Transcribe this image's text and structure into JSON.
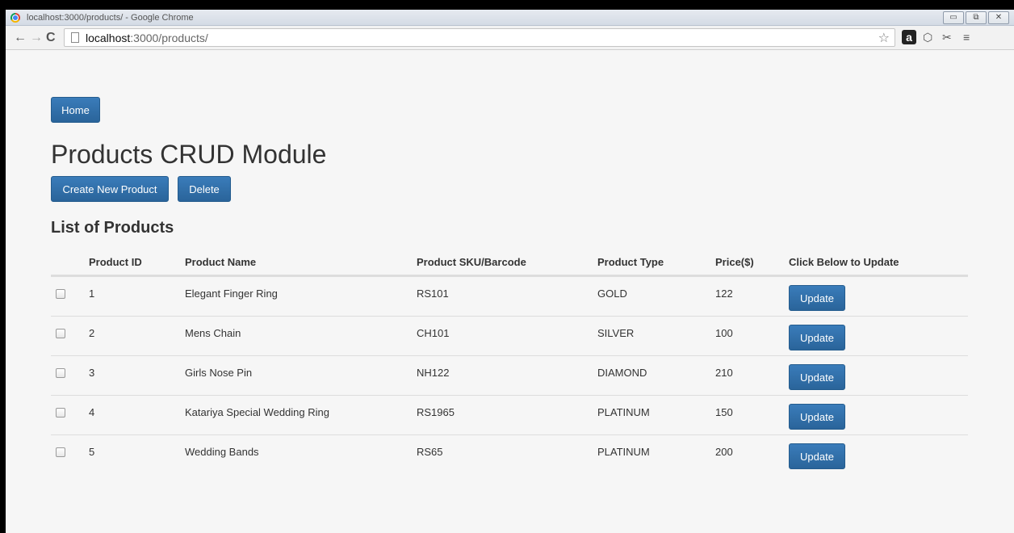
{
  "window": {
    "title": "localhost:3000/products/ - Google Chrome",
    "controls": {
      "minimize": "▭",
      "restore": "⧉",
      "close": "✕"
    }
  },
  "toolbar": {
    "url_host": "localhost",
    "url_path": ":3000/products/",
    "icons": [
      "back-arrow-icon",
      "forward-arrow-icon",
      "reload-icon",
      "page-icon",
      "star-icon",
      "amazon-extension-icon",
      "cube-extension-icon",
      "tools-extension-icon",
      "menu-icon"
    ]
  },
  "page": {
    "home_label": "Home",
    "title": "Products CRUD Module",
    "create_label": "Create New Product",
    "delete_label": "Delete",
    "subtitle": "List of Products"
  },
  "table": {
    "headers": {
      "id": "Product ID",
      "name": "Product Name",
      "sku": "Product SKU/Barcode",
      "type": "Product Type",
      "price": "Price($)",
      "update": "Click Below to Update"
    },
    "update_label": "Update",
    "rows": [
      {
        "id": "1",
        "name": "Elegant Finger Ring",
        "sku": "RS101",
        "type": "GOLD",
        "price": "122"
      },
      {
        "id": "2",
        "name": "Mens Chain",
        "sku": "CH101",
        "type": "SILVER",
        "price": "100"
      },
      {
        "id": "3",
        "name": "Girls Nose Pin",
        "sku": "NH122",
        "type": "DIAMOND",
        "price": "210"
      },
      {
        "id": "4",
        "name": "Katariya Special Wedding Ring",
        "sku": "RS1965",
        "type": "PLATINUM",
        "price": "150"
      },
      {
        "id": "5",
        "name": "Wedding Bands",
        "sku": "RS65",
        "type": "PLATINUM",
        "price": "200"
      }
    ]
  },
  "colors": {
    "primary_button": "#2f6fa9",
    "page_background": "#f6f6f6"
  }
}
